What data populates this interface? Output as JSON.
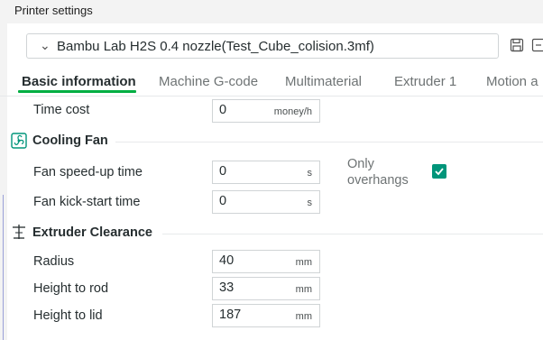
{
  "window": {
    "title": "Printer settings"
  },
  "preset": {
    "name": "Bambu Lab H2S 0.4 nozzle(Test_Cube_colision.3mf)"
  },
  "tabs": [
    {
      "label": "Basic information"
    },
    {
      "label": "Machine G-code"
    },
    {
      "label": "Multimaterial"
    },
    {
      "label": "Extruder 1"
    },
    {
      "label": "Motion a"
    }
  ],
  "time_cost": {
    "label": "Time cost",
    "value": "0",
    "unit": "money/h"
  },
  "cooling_fan": {
    "title": "Cooling Fan",
    "speed_up": {
      "label": "Fan speed-up time",
      "value": "0",
      "unit": "s"
    },
    "kick_start": {
      "label": "Fan kick-start time",
      "value": "0",
      "unit": "s"
    },
    "only_overhangs": {
      "label_line1": "Only",
      "label_line2": "overhangs",
      "checked": true
    }
  },
  "extruder_clearance": {
    "title": "Extruder Clearance",
    "radius": {
      "label": "Radius",
      "value": "40",
      "unit": "mm"
    },
    "height_rod": {
      "label": "Height to rod",
      "value": "33",
      "unit": "mm"
    },
    "height_lid": {
      "label": "Height to lid",
      "value": "187",
      "unit": "mm"
    }
  },
  "colors": {
    "accent": "#00ae42",
    "checkbox": "#00957a"
  }
}
